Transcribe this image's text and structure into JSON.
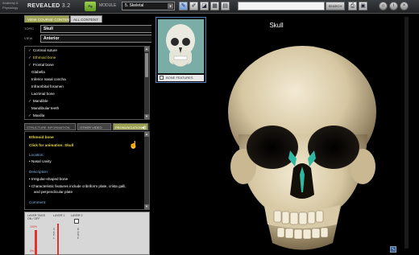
{
  "app": {
    "logo_small_1": "Anatomy &",
    "logo_small_2": "Physiology",
    "logo_big": "REVEALED",
    "version": "3.2",
    "home_label": "Pg",
    "module_label": "MODULE",
    "module_value": "5. Skeletal",
    "search_placeholder": "",
    "search_label": "SEARCH",
    "tools": [
      "pencil-icon",
      "pen-icon",
      "eraser-icon",
      "grid-icon",
      "layers-icon",
      "print-icon",
      "image-icon",
      "info-icon"
    ],
    "window_controls": [
      "home-icon",
      "info-icon",
      "close-icon"
    ]
  },
  "left_panel": {
    "tabs": [
      "VIEW COURSE CONTENT",
      "ALL CONTENT"
    ],
    "topic_label": "TOPIC",
    "topic_value": "Skull",
    "view_label": "VIEW",
    "view_value": "Anterior",
    "structures": [
      {
        "label": "Coronal suture",
        "checked": true,
        "selected": false
      },
      {
        "label": "Ethmoid bone",
        "checked": true,
        "selected": true
      },
      {
        "label": "Frontal bone",
        "checked": true,
        "selected": false
      },
      {
        "label": "Glabella",
        "checked": false,
        "selected": false
      },
      {
        "label": "Inferior nasal concha",
        "checked": false,
        "selected": false
      },
      {
        "label": "Infraorbital foramen",
        "checked": false,
        "selected": false
      },
      {
        "label": "Lacrimal bone",
        "checked": false,
        "selected": false
      },
      {
        "label": "Mandible",
        "checked": true,
        "selected": false
      },
      {
        "label": "Mandibular teeth",
        "checked": false,
        "selected": false
      },
      {
        "label": "Maxilla",
        "checked": true,
        "selected": false
      }
    ],
    "info_tabs": [
      "STRUCTURE INFORMATION",
      "OTHER VIDEO",
      "PRONUNCIATION"
    ],
    "info": {
      "name": "Ethmoid bone",
      "animation_prefix": "Click for animation:",
      "animation_link": "Skull",
      "location_heading": "Location:",
      "location_item": "Nasal cavity",
      "description_heading": "Description:",
      "description_items": [
        "Irregular-shaped bone",
        "Characteristic features include cribriform plate, crista galli,",
        "and perpendicular plate"
      ],
      "comment_heading": "Comment:"
    },
    "layers": {
      "tags_label_1": "LAYER TAGS",
      "tags_label_2": "ON / OFF",
      "layer1": "LAYER 1",
      "layer2": "LAYER 2",
      "pct": "100%",
      "pct2": "0%"
    }
  },
  "viewer": {
    "title": "Skull",
    "thumb_label": "BONE FEATURES"
  }
}
